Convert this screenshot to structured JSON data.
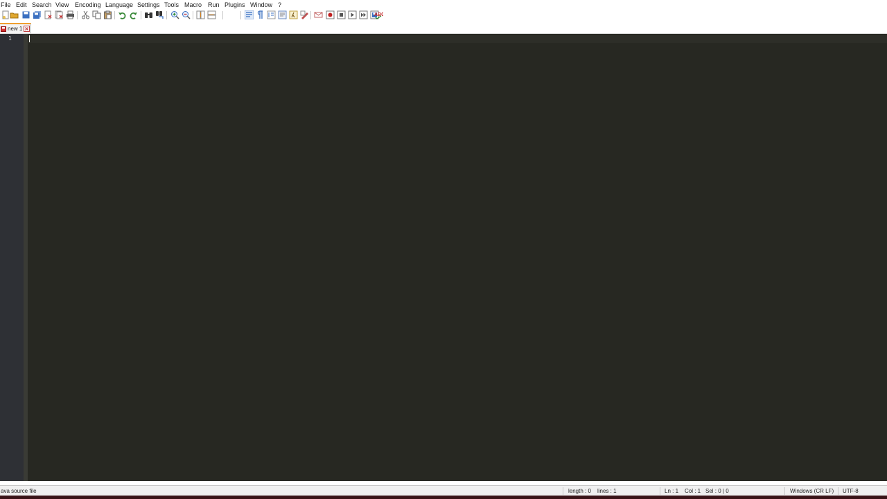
{
  "menu": {
    "items": [
      "File",
      "Edit",
      "Search",
      "View",
      "Encoding",
      "Language",
      "Settings",
      "Tools",
      "Macro",
      "Run",
      "Plugins",
      "Window",
      "?"
    ]
  },
  "toolbar": {
    "buttons": [
      {
        "name": "new-file-icon",
        "color": "#e8c050"
      },
      {
        "name": "open-file-icon",
        "color": "#e0a830"
      },
      {
        "name": "save-icon",
        "color": "#3a6fc0"
      },
      {
        "name": "save-all-icon",
        "color": "#3a6fc0"
      },
      {
        "name": "close-icon",
        "color": "#7a7a7a"
      },
      {
        "name": "close-all-icon",
        "color": "#7a7a7a"
      },
      {
        "name": "print-icon",
        "color": "#555555"
      },
      {
        "name": "cut-icon",
        "color": "#666666"
      },
      {
        "name": "copy-icon",
        "color": "#666666"
      },
      {
        "name": "paste-icon",
        "color": "#666666"
      },
      {
        "name": "undo-icon",
        "color": "#3a8a3a"
      },
      {
        "name": "redo-icon",
        "color": "#3a8a3a"
      },
      {
        "name": "find-icon",
        "color": "#333333"
      },
      {
        "name": "replace-icon",
        "color": "#3a6fc0"
      },
      {
        "name": "zoom-in-icon",
        "color": "#3a6fc0"
      },
      {
        "name": "zoom-out-icon",
        "color": "#3a6fc0"
      },
      {
        "name": "sync-vertical-icon",
        "color": "#888888"
      },
      {
        "name": "sync-horizontal-icon",
        "color": "#888888"
      },
      {
        "name": "word-wrap-icon",
        "color": "#3a6fc0"
      },
      {
        "name": "show-all-chars-icon",
        "color": "#3a6fc0"
      },
      {
        "name": "indent-guide-icon",
        "color": "#3a6fc0"
      },
      {
        "name": "document-map-icon",
        "color": "#6a8ac0"
      },
      {
        "name": "function-list-icon",
        "color": "#c0a040"
      },
      {
        "name": "folder-as-workspace-icon",
        "color": "#c05050"
      },
      {
        "name": "monitoring-icon",
        "color": "#c06060"
      },
      {
        "name": "record-macro-icon",
        "color": "#c02020"
      },
      {
        "name": "stop-recording-icon",
        "color": "#555555"
      },
      {
        "name": "playback-macro-icon",
        "color": "#555555"
      },
      {
        "name": "run-macro-multiple-icon",
        "color": "#555555"
      },
      {
        "name": "save-macro-icon",
        "color": "#555555"
      },
      {
        "name": "spell-check-icon",
        "color": "#c02020"
      }
    ]
  },
  "tabs": [
    {
      "label": "new 1"
    }
  ],
  "editor": {
    "line_numbers": [
      "1"
    ],
    "theme_bg": "#272822"
  },
  "status": {
    "hint": "ava source file",
    "length": "length : 0",
    "lines": "lines : 1",
    "ln": "Ln : 1",
    "col": "Col : 1",
    "sel": "Sel : 0 | 0",
    "eol": "Windows (CR LF)",
    "encoding": "UTF-8"
  }
}
